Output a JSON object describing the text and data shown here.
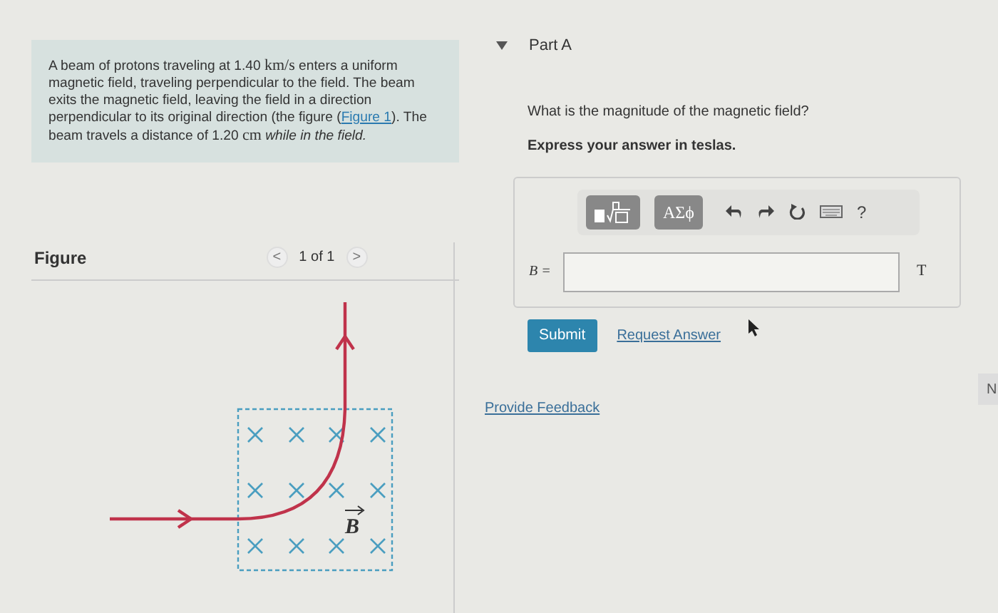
{
  "problem": {
    "parts": [
      {
        "kind": "text",
        "text": "A beam of protons traveling at 1.40 "
      },
      {
        "kind": "unit",
        "text": "km/s"
      },
      {
        "kind": "text",
        "text": " enters a uniform magnetic field, traveling perpendicular to the field. The beam exits the magnetic field, leaving the field in a direction perpendicular to its original direction (the figure ("
      },
      {
        "kind": "link",
        "text": "Figure 1"
      },
      {
        "kind": "text",
        "text": "). The beam travels a distance of 1.20 "
      },
      {
        "kind": "unit",
        "text": "cm"
      },
      {
        "kind": "italic",
        "text": " while in the field."
      }
    ]
  },
  "figure": {
    "title": "Figure",
    "prev": "<",
    "pager": "1 of 1",
    "next": ">",
    "field_label": "B"
  },
  "part": {
    "expanded": true,
    "title": "Part A",
    "question": "What is the magnitude of the magnetic field?",
    "instruction": "Express your answer in teslas.",
    "toolbar": [
      {
        "kind": "template"
      },
      {
        "kind": "greek",
        "text": "ΑΣϕ"
      },
      {
        "kind": "undo"
      },
      {
        "kind": "redo"
      },
      {
        "kind": "reset"
      },
      {
        "kind": "keyboard"
      },
      {
        "kind": "help",
        "text": "?"
      }
    ],
    "answer": {
      "label": "B =",
      "unit": "T"
    },
    "submit": "Submit",
    "request": "Request Answer"
  },
  "feedback": "Provide Feedback",
  "next": "N"
}
